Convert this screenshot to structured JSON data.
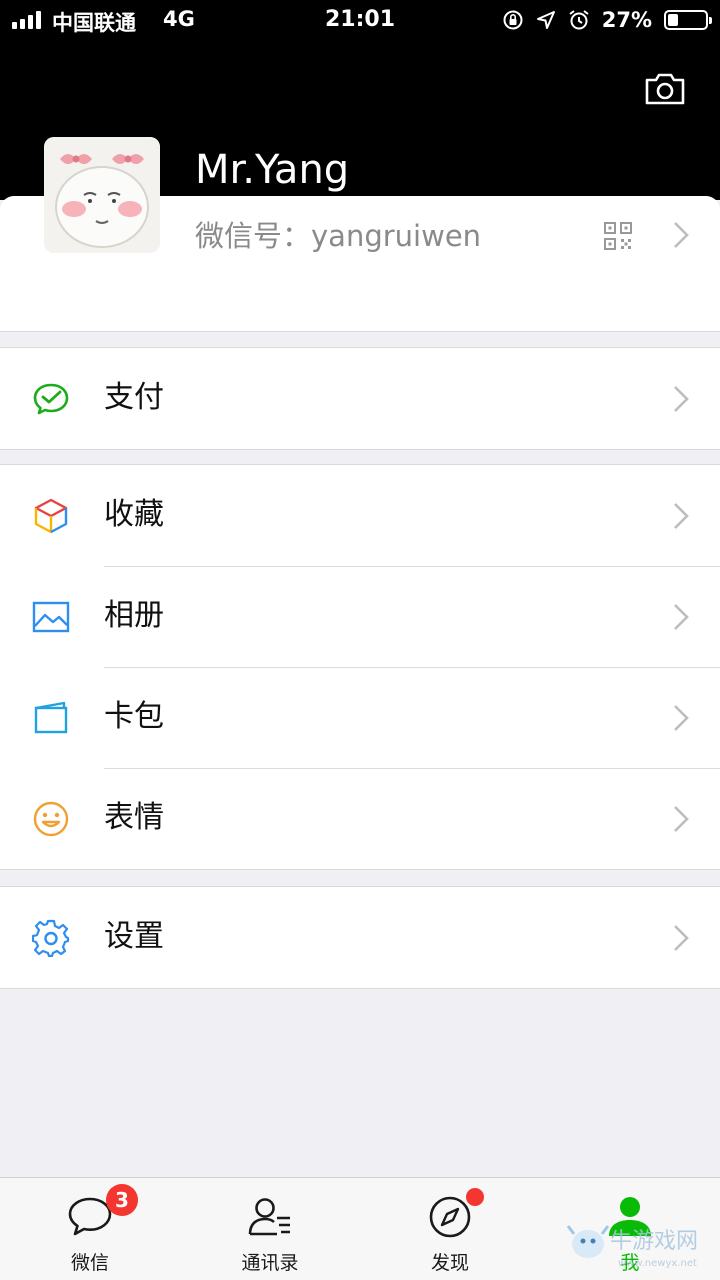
{
  "status_bar": {
    "carrier": "中国联通",
    "network": "4G",
    "time": "21:01",
    "battery_percent": "27%",
    "battery_level": 0.27,
    "icons": [
      "orientation-lock-icon",
      "location-icon",
      "alarm-icon"
    ]
  },
  "header": {
    "camera_icon": "camera-icon"
  },
  "profile": {
    "name": "Mr.Yang",
    "wechat_id_label": "微信号：",
    "wechat_id": "yangruiwen",
    "qr_icon": "qr-code-icon"
  },
  "menu": {
    "pay": {
      "label": "支付",
      "icon": "wechat-pay-icon"
    },
    "favorites": {
      "label": "收藏",
      "icon": "cube-icon"
    },
    "album": {
      "label": "相册",
      "icon": "album-icon"
    },
    "cards": {
      "label": "卡包",
      "icon": "card-wallet-icon"
    },
    "stickers": {
      "label": "表情",
      "icon": "smile-icon"
    },
    "settings": {
      "label": "设置",
      "icon": "gear-icon"
    }
  },
  "tabs": [
    {
      "label": "微信",
      "icon": "chat-bubble-icon",
      "badge": "3"
    },
    {
      "label": "通讯录",
      "icon": "contacts-icon"
    },
    {
      "label": "发现",
      "icon": "compass-icon",
      "dot": true
    },
    {
      "label": "我",
      "icon": "person-icon",
      "active": true
    }
  ],
  "watermark": {
    "text": "牛游戏网",
    "url_text": "www.newyx.net"
  },
  "colors": {
    "accent": "#09bb07",
    "badge": "#f43530",
    "header_bg": "#000000",
    "page_bg": "#efeff4"
  }
}
